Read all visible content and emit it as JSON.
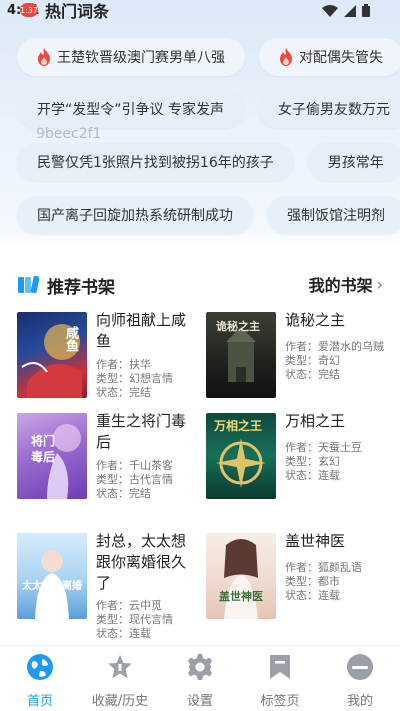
{
  "status": {
    "time": "4:11",
    "badge": "1:37"
  },
  "hot_section": {
    "title": "热门词条"
  },
  "hot_rows": [
    {
      "chips": [
        "王楚钦晋级澳门赛男单八强",
        "对配偶失管失"
      ]
    },
    {
      "chips": [
        "开学“发型令”引争议 专家发声",
        "女子偷男友数万元"
      ]
    },
    {
      "chips": [
        "民警仅凭1张照片找到被拐16年的孩子",
        "男孩常年"
      ]
    },
    {
      "chips": [
        "国产离子回旋加热系统研制成功",
        "强制饭馆注明剂"
      ]
    }
  ],
  "overlay_code": "9beec2f1",
  "shelf": {
    "title": "推荐书架",
    "my_shelf": "我的书架"
  },
  "labels": {
    "author": "作者：",
    "type": "类型：",
    "status": "状态："
  },
  "books": [
    {
      "title": "向师祖献上咸鱼",
      "author": "扶华",
      "type": "幻想言情",
      "status": "完结"
    },
    {
      "title": "诡秘之主",
      "author": "爱潜水的乌贼",
      "type": "奇幻",
      "status": "完结"
    },
    {
      "title": "重生之将门毒后",
      "author": "千山茶客",
      "type": "古代言情",
      "status": "完结"
    },
    {
      "title": "万相之王",
      "author": "天蚕土豆",
      "type": "玄幻",
      "status": "连载"
    },
    {
      "title": "封总，太太想跟你离婚很久了",
      "author": "云中觅",
      "type": "现代言情",
      "status": "连载"
    },
    {
      "title": "盖世神医",
      "author": "狐颜乱语",
      "type": "都市",
      "status": "连载"
    }
  ],
  "covers": [
    {
      "text": "咸鱼"
    },
    {
      "text": "诡秘之主"
    },
    {
      "text": "将门毒后"
    },
    {
      "text": "万相之王"
    },
    {
      "text": "太太想你离婚很久了"
    },
    {
      "text": "盖世神医"
    }
  ],
  "tabs": [
    {
      "label": "首页",
      "icon": "globe-icon"
    },
    {
      "label": "收藏/历史",
      "icon": "star-icon"
    },
    {
      "label": "设置",
      "icon": "gear-icon"
    },
    {
      "label": "标签页",
      "icon": "bookmark-icon"
    },
    {
      "label": "我的",
      "icon": "profile-icon"
    }
  ],
  "colors": {
    "accent": "#1e9bf0",
    "hot_flame": "#f2453d",
    "inactive_icon": "#9aa0a6"
  }
}
